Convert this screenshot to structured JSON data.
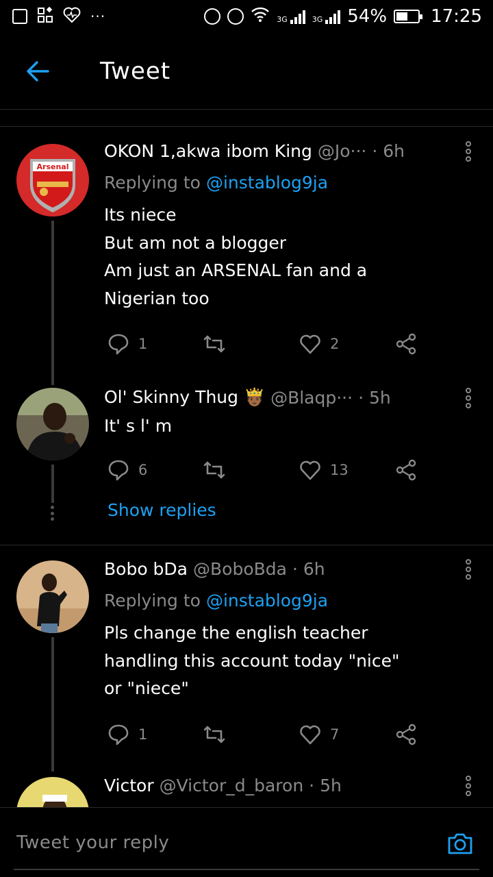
{
  "status_bar": {
    "more": "···",
    "net1": "3G",
    "net2": "3G",
    "battery_pct": "54%",
    "battery_level": 0.54,
    "time": "17:25"
  },
  "header": {
    "title": "Tweet"
  },
  "tweets": [
    {
      "name": "OKON 1,akwa ibom King",
      "handle": "@Jo···",
      "time": "· 6h",
      "replying_label": "Replying to",
      "replying_to": "@instablog9ja",
      "text": "Its niece\nBut am not a blogger\nAm just an ARSENAL fan and a\nNigerian too",
      "replies": "1",
      "retweets": "",
      "likes": "2",
      "avatar": "arsenal-crest"
    },
    {
      "name": "Ol' Skinny Thug 🤴🏾",
      "handle": "@Blaqp···",
      "time": "· 5h",
      "text": "It' s l' m",
      "replies": "6",
      "retweets": "",
      "likes": "13",
      "avatar": "man-photo"
    },
    {
      "name": "Bobo bDa",
      "handle": "@BoboBda",
      "time": "· 6h",
      "replying_label": "Replying to",
      "replying_to": "@instablog9ja",
      "text": "Pls change the english teacher\nhandling this account today \"nice\"\nor \"niece\"",
      "replies": "1",
      "retweets": "",
      "likes": "7",
      "avatar": "man-photo"
    },
    {
      "name": "Victor",
      "handle": "@Victor_d_baron",
      "time": "· 5h",
      "avatar": "man-photo"
    }
  ],
  "show_replies": "Show replies",
  "composer": {
    "placeholder": "Tweet your reply"
  },
  "colors": {
    "accent": "#1da1f2",
    "muted": "#8a8a8a",
    "background": "#000000"
  }
}
